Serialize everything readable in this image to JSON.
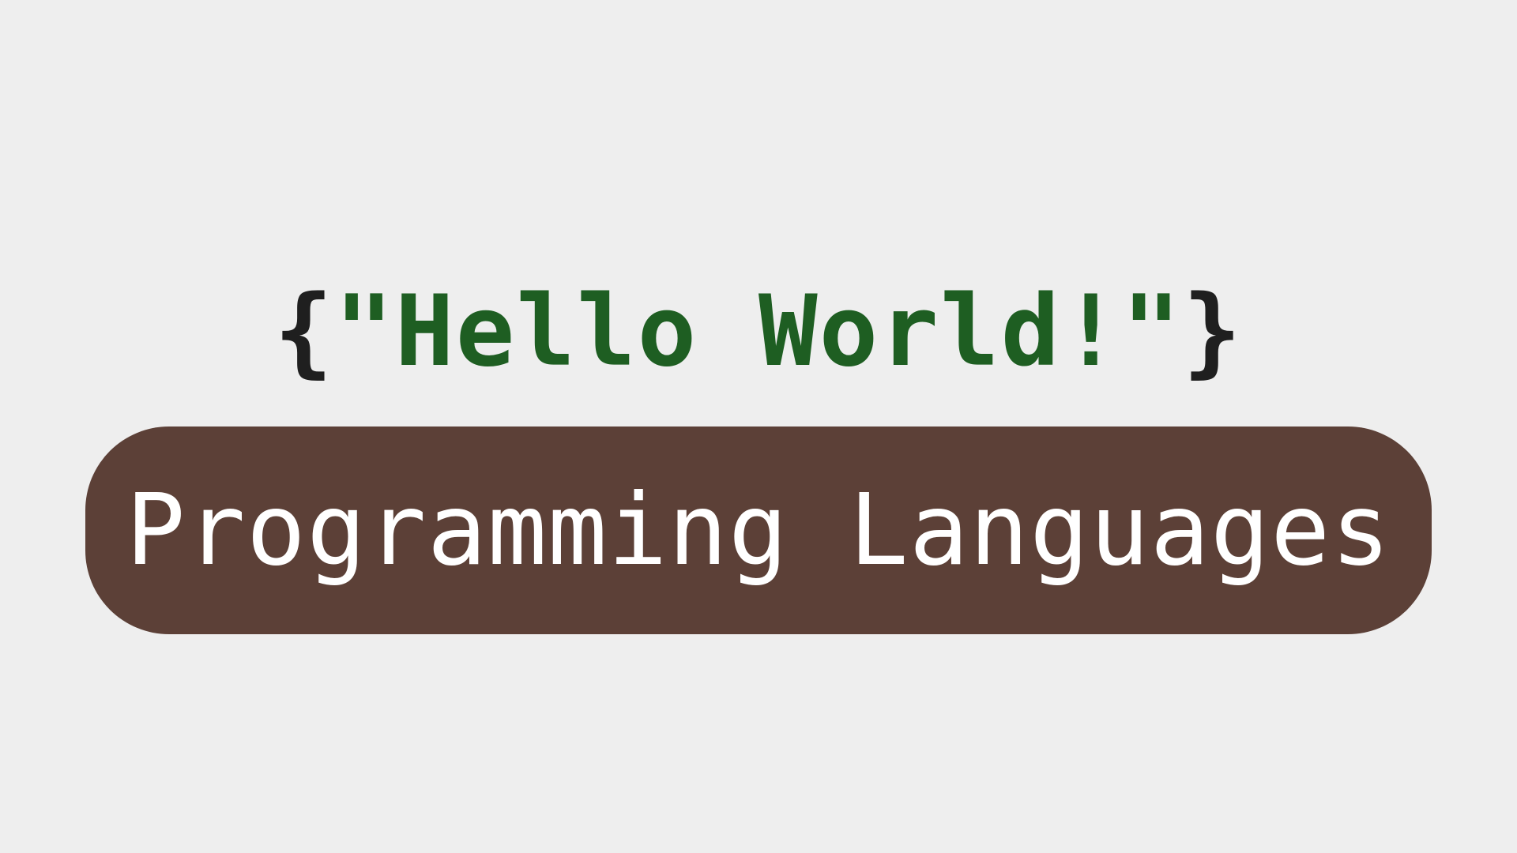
{
  "headline": {
    "open_brace": "{",
    "text": "\"Hello World!\"",
    "close_brace": "}"
  },
  "banner": {
    "label": "Programming Languages"
  },
  "colors": {
    "background": "#eeeeee",
    "brace": "#1f1f1f",
    "headline_text": "#1e5e22",
    "banner_fill": "#5c4037",
    "banner_text": "#ffffff"
  }
}
